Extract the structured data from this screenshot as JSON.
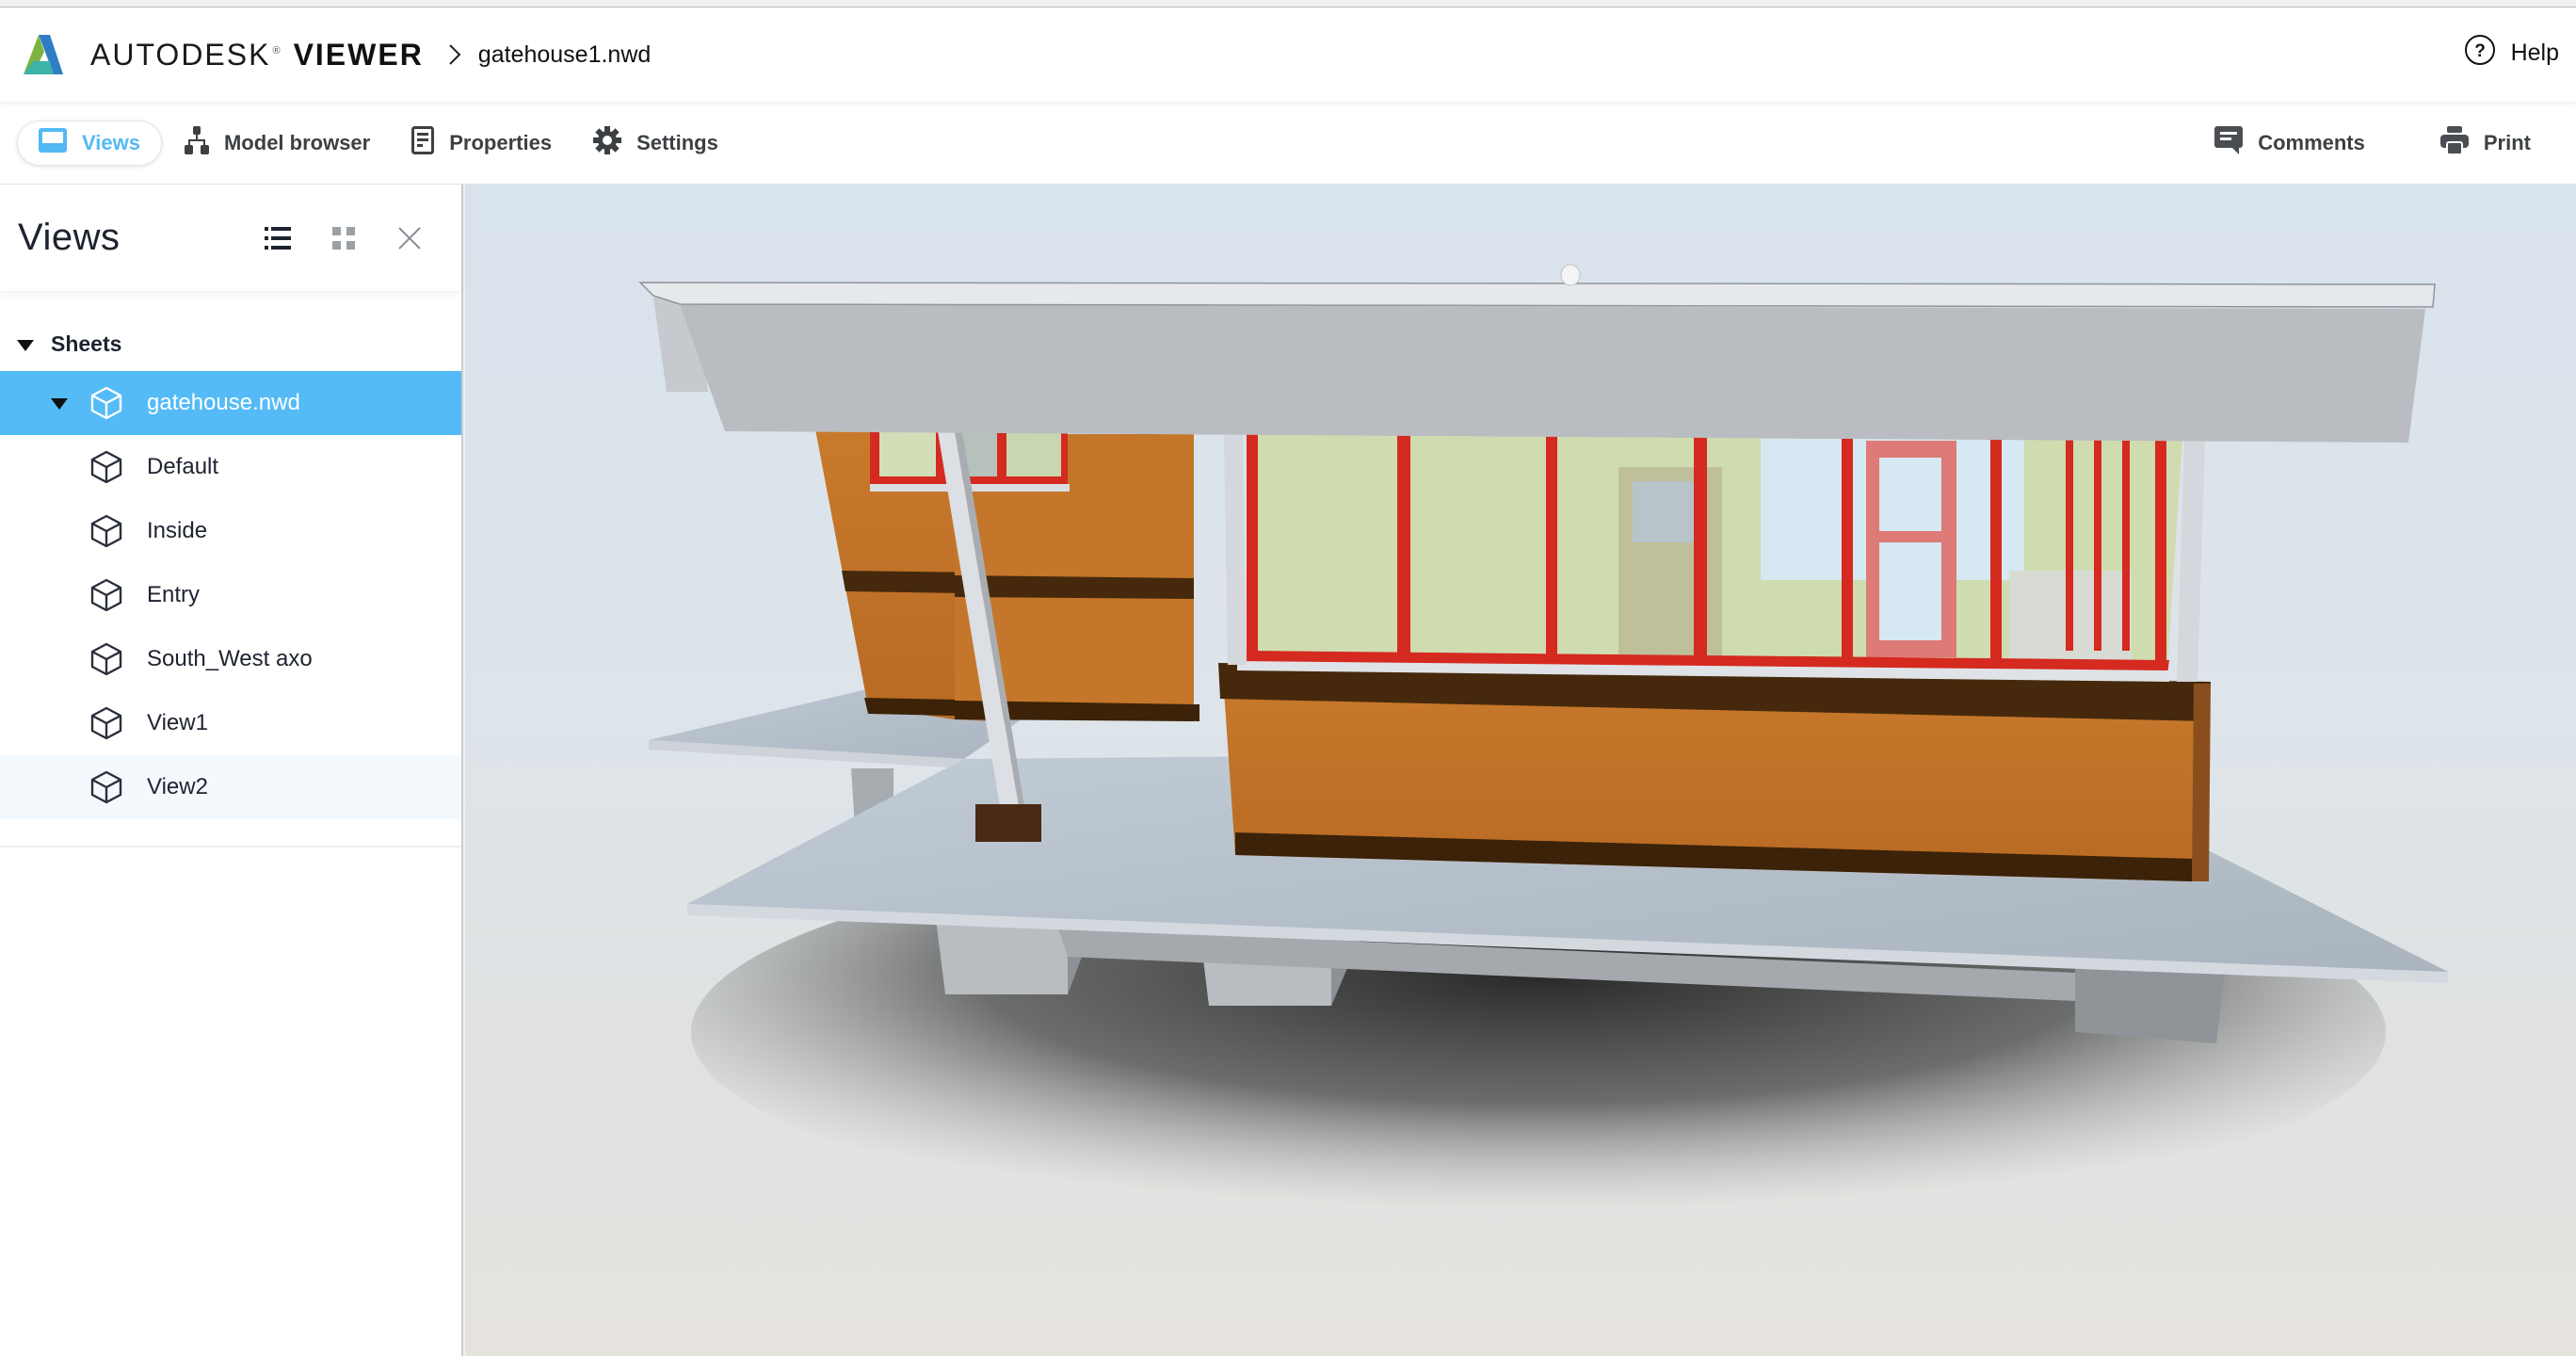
{
  "header": {
    "brand": "AUTODESK",
    "brand_reg": "®",
    "product": "VIEWER",
    "breadcrumb_file": "gatehouse1.nwd",
    "help_label": "Help"
  },
  "toolbar": {
    "left": [
      {
        "label": "Views",
        "icon": "views-icon",
        "active": true
      },
      {
        "label": "Model browser",
        "icon": "model-browser-icon",
        "active": false
      },
      {
        "label": "Properties",
        "icon": "properties-icon",
        "active": false
      },
      {
        "label": "Settings",
        "icon": "gear-icon",
        "active": false
      }
    ],
    "right": [
      {
        "label": "Comments",
        "icon": "comment-icon"
      },
      {
        "label": "Print",
        "icon": "print-icon"
      }
    ]
  },
  "sidebar": {
    "title": "Views",
    "view_modes": [
      "list",
      "grid"
    ],
    "active_mode": "list",
    "section_label": "Sheets",
    "root": {
      "label": "gatehouse.nwd",
      "selected": true,
      "expanded": true
    },
    "items": [
      {
        "label": "Default"
      },
      {
        "label": "Inside"
      },
      {
        "label": "Entry"
      },
      {
        "label": "South_West axo"
      },
      {
        "label": "View1"
      },
      {
        "label": "View2",
        "hovered": true
      }
    ]
  },
  "viewport": {
    "model_name": "gatehouse",
    "colors": {
      "accent": "#54bbf6",
      "roof_fascia": "#b9bdc1",
      "roof_top": "#e6e9ec",
      "wall_orange": "#c4762a",
      "band_brown": "#46290c",
      "window_frame": "#d42a20",
      "interior_green": "#cfdcb0",
      "slab": "#b9c4cf"
    }
  }
}
